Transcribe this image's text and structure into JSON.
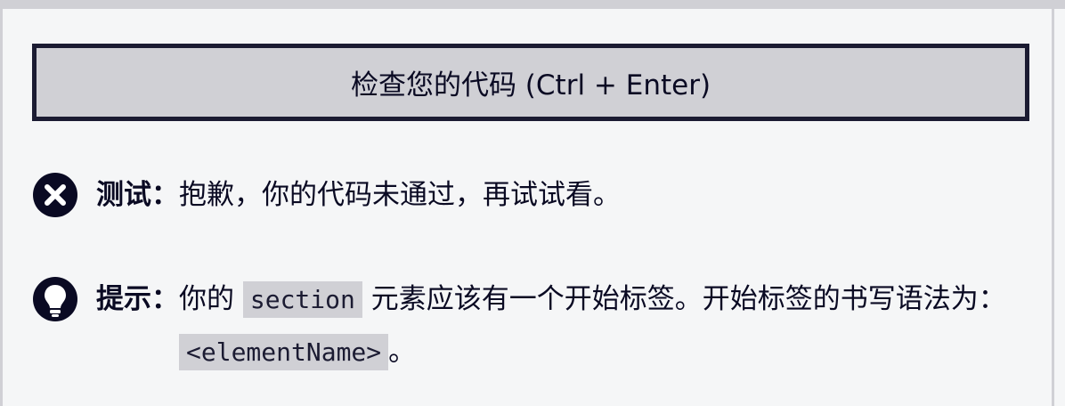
{
  "check_button": {
    "label": "检查您的代码 (Ctrl + Enter)"
  },
  "test_result": {
    "icon": "close-circle-icon",
    "label": "测试：",
    "message": "抱歉，你的代码未通过，再试试看。"
  },
  "hint": {
    "icon": "lightbulb-icon",
    "label": "提示：",
    "text_before": "你的 ",
    "code_1": "section",
    "text_middle": " 元素应该有一个开始标签。开始标签的书写语法为： ",
    "code_2": "<elementName>",
    "text_after": "。"
  },
  "colors": {
    "background": "#f5f6f7",
    "button_bg": "#d0d0d5",
    "button_border": "#1b1b32",
    "icon": "#0a0a23"
  }
}
